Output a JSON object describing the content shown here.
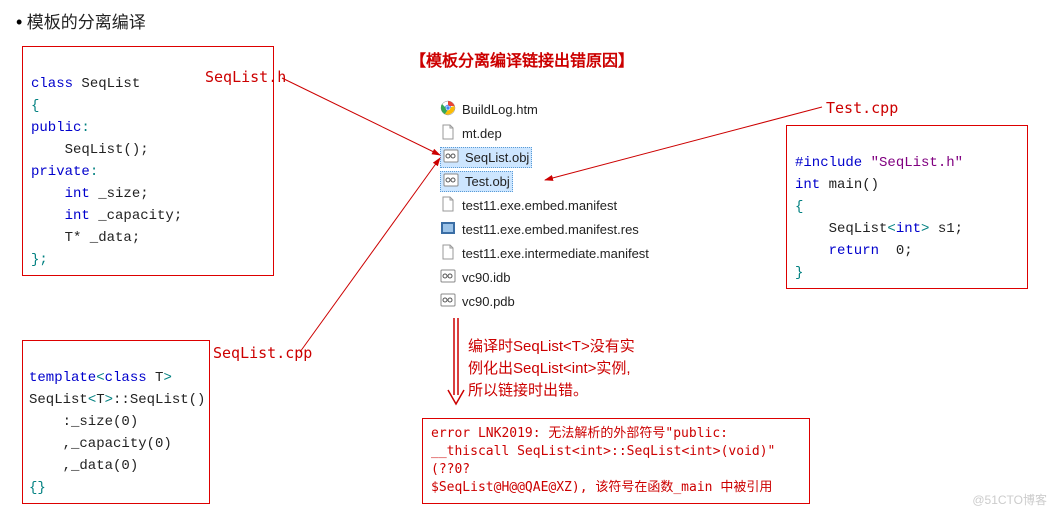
{
  "heading": "模板的分离编译",
  "title": "【模板分离编译链接出错原因】",
  "labels": {
    "seqlist_h": "SeqList.h",
    "seqlist_cpp": "SeqList.cpp",
    "test_cpp": "Test.cpp"
  },
  "code": {
    "seqlist_h": {
      "l1_kw": "class",
      "l1_name": " SeqList",
      "l2": "{",
      "l3_kw": "public",
      "l3_colon": ":",
      "l4": "    SeqList();",
      "l5_kw": "private",
      "l5_colon": ":",
      "l6_kw": "    int",
      "l6_rest": " _size;",
      "l7_kw": "    int",
      "l7_rest": " _capacity;",
      "l8": "    T* _data;",
      "l9": "};"
    },
    "seqlist_cpp": {
      "l1a_kw": "template",
      "l1a_p1": "<",
      "l1a_kw2": "class",
      "l1a_t": " T",
      "l1a_p2": ">",
      "l2a": "SeqList",
      "l2b_p1": "<",
      "l2b_t": "T",
      "l2b_p2": ">",
      "l2c": "::SeqList()",
      "l3": "    :_size(0)",
      "l4": "    ,_capacity(0)",
      "l5": "    ,_data(0)",
      "l6": "{}"
    },
    "test_cpp": {
      "l1_kw": "#include",
      "l1_str": " \"SeqList.h\"",
      "l2_kw": "int",
      "l2_rest": " main()",
      "l3": "{",
      "l4a": "    SeqList",
      "l4_p1": "<",
      "l4_kw": "int",
      "l4_p2": ">",
      "l4b": " s1;",
      "l5_kw": "    return",
      "l5_rest": "  0;",
      "l6": "}"
    }
  },
  "files": [
    {
      "name": "BuildLog.htm",
      "icon": "chrome"
    },
    {
      "name": "mt.dep",
      "icon": "generic"
    },
    {
      "name": "SeqList.obj",
      "icon": "obj",
      "hl": true
    },
    {
      "name": "Test.obj",
      "icon": "obj",
      "hl": true
    },
    {
      "name": "test11.exe.embed.manifest",
      "icon": "generic"
    },
    {
      "name": "test11.exe.embed.manifest.res",
      "icon": "res"
    },
    {
      "name": "test11.exe.intermediate.manifest",
      "icon": "generic"
    },
    {
      "name": "vc90.idb",
      "icon": "obj"
    },
    {
      "name": "vc90.pdb",
      "icon": "obj"
    }
  ],
  "note": {
    "l1": "编译时SeqList<T>没有实",
    "l2": "例化出SeqList<int>实例,",
    "l3": "所以链接时出错。"
  },
  "error": {
    "l1": "error LNK2019: 无法解析的外部符号\"public:",
    "l2": "__thiscall SeqList<int>::SeqList<int>(void)\" (??0?",
    "l3": "$SeqList@H@@QAE@XZ), 该符号在函数_main 中被引用"
  },
  "watermark": "@51CTO博客"
}
